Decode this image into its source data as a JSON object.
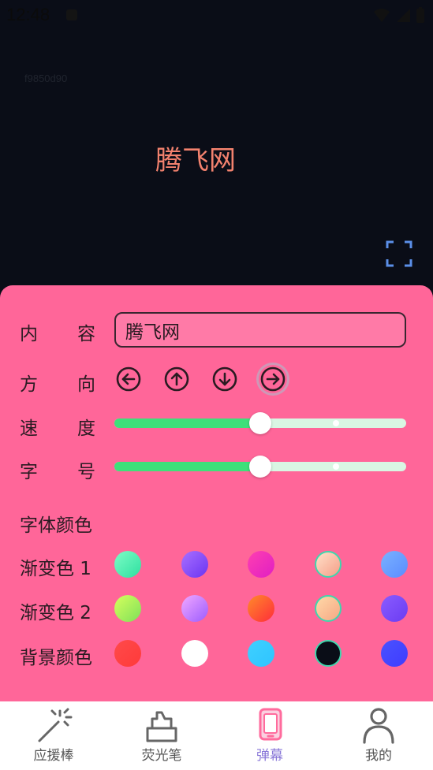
{
  "status_bar": {
    "time": "12:48"
  },
  "preview": {
    "id_text": "f9850d90",
    "text": "腾飞网",
    "text_color": "#f3826e"
  },
  "panel": {
    "background": "#ff6699",
    "content": {
      "label_a": "内",
      "label_b": "容",
      "value": "腾飞网"
    },
    "direction": {
      "label_a": "方",
      "label_b": "向",
      "buttons": [
        {
          "icon": "arrow-left-circle-icon",
          "active": false
        },
        {
          "icon": "arrow-up-circle-icon",
          "active": false
        },
        {
          "icon": "arrow-down-circle-icon",
          "active": false
        },
        {
          "icon": "arrow-right-circle-icon",
          "active": true
        }
      ]
    },
    "speed": {
      "label_a": "速",
      "label_b": "度",
      "value": 0.5,
      "buffer": 0.76
    },
    "font_size": {
      "label_a": "字",
      "label_b": "号",
      "value": 0.5,
      "buffer": 0.76
    },
    "font_color_title": "字体颜色",
    "gradient1": {
      "label": "渐变色 1",
      "swatches": [
        {
          "from": "#7dfcc6",
          "to": "#2ee0a0",
          "selected": false
        },
        {
          "from": "#a970ff",
          "to": "#6a34f2",
          "selected": false
        },
        {
          "from": "#ff3fb0",
          "to": "#e01fc4",
          "selected": false
        },
        {
          "from": "#ffe0c8",
          "to": "#f59e88",
          "selected": true
        },
        {
          "from": "#7ab2ff",
          "to": "#5a8cff",
          "selected": false
        }
      ]
    },
    "gradient2": {
      "label": "渐变色 2",
      "swatches": [
        {
          "from": "#d7ff5c",
          "to": "#7ee05a",
          "selected": false
        },
        {
          "from": "#f2a8ff",
          "to": "#9b5cff",
          "selected": false
        },
        {
          "from": "#ff8a2a",
          "to": "#ff2d3a",
          "selected": false
        },
        {
          "from": "#ffd9a8",
          "to": "#f5a784",
          "selected": true
        },
        {
          "from": "#8a5cff",
          "to": "#6b3cf2",
          "selected": false
        }
      ]
    },
    "background_color": {
      "label": "背景颜色",
      "swatches": [
        {
          "from": "#ff4a4a",
          "to": "#ff3a3a",
          "selected": false
        },
        {
          "from": "#ffffff",
          "to": "#ffffff",
          "selected": false
        },
        {
          "from": "#3fd0ff",
          "to": "#2fc4ff",
          "selected": false
        },
        {
          "from": "#0a0d17",
          "to": "#0a0d17",
          "selected": true
        },
        {
          "from": "#4a52ff",
          "to": "#3f3cff",
          "selected": false
        }
      ]
    }
  },
  "bottom_nav": {
    "items": [
      {
        "label": "应援棒",
        "icon": "magic-wand-icon",
        "active": false
      },
      {
        "label": "荧光笔",
        "icon": "highlighter-icon",
        "active": false
      },
      {
        "label": "弹幕",
        "icon": "phone-barrage-icon",
        "active": true
      },
      {
        "label": "我的",
        "icon": "user-icon",
        "active": false
      }
    ]
  }
}
